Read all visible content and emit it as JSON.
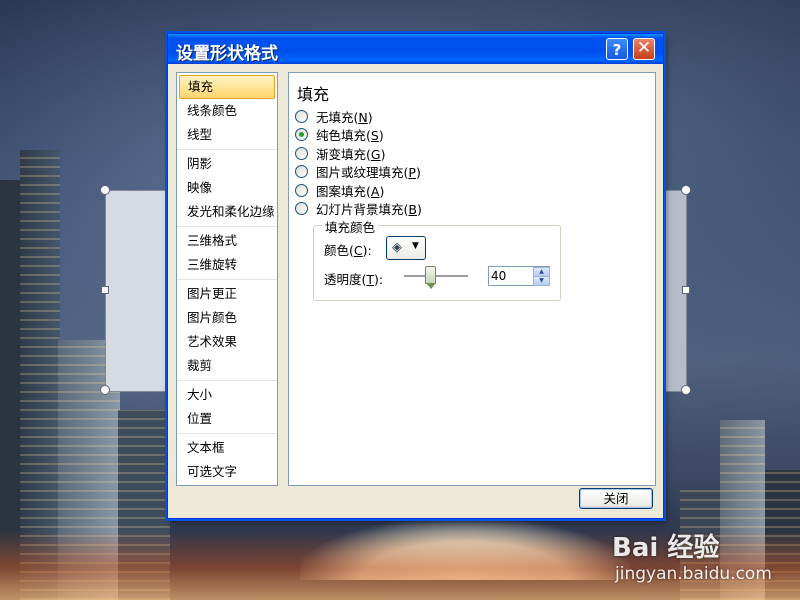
{
  "dialog": {
    "title": "设置形状格式",
    "help_glyph": "?",
    "close_glyph": "✕",
    "close_button_label": "关闭"
  },
  "nav": {
    "groups": [
      [
        {
          "label": "填充",
          "active": true
        },
        {
          "label": "线条颜色"
        },
        {
          "label": "线型"
        }
      ],
      [
        {
          "label": "阴影"
        },
        {
          "label": "映像"
        },
        {
          "label": "发光和柔化边缘"
        }
      ],
      [
        {
          "label": "三维格式"
        },
        {
          "label": "三维旋转"
        }
      ],
      [
        {
          "label": "图片更正"
        },
        {
          "label": "图片颜色"
        },
        {
          "label": "艺术效果"
        },
        {
          "label": "裁剪"
        }
      ],
      [
        {
          "label": "大小"
        },
        {
          "label": "位置"
        }
      ],
      [
        {
          "label": "文本框"
        },
        {
          "label": "可选文字"
        }
      ]
    ]
  },
  "fill": {
    "heading": "填充",
    "options": [
      {
        "label": "无填充",
        "key": "N",
        "checked": false
      },
      {
        "label": "纯色填充",
        "key": "S",
        "checked": true
      },
      {
        "label": "渐变填充",
        "key": "G",
        "checked": false
      },
      {
        "label": "图片或纹理填充",
        "key": "P",
        "checked": false
      },
      {
        "label": "图案填充",
        "key": "A",
        "checked": false
      },
      {
        "label": "幻灯片背景填充",
        "key": "B",
        "checked": false
      }
    ],
    "group_label": "填充颜色",
    "color_label": "颜色",
    "color_key": "C",
    "transparency_label": "透明度",
    "transparency_key": "T",
    "transparency_value": "40",
    "transparency_fraction": 0.4
  },
  "watermark": {
    "text": "Bai 经验",
    "url": "jingyan.baidu.com"
  }
}
